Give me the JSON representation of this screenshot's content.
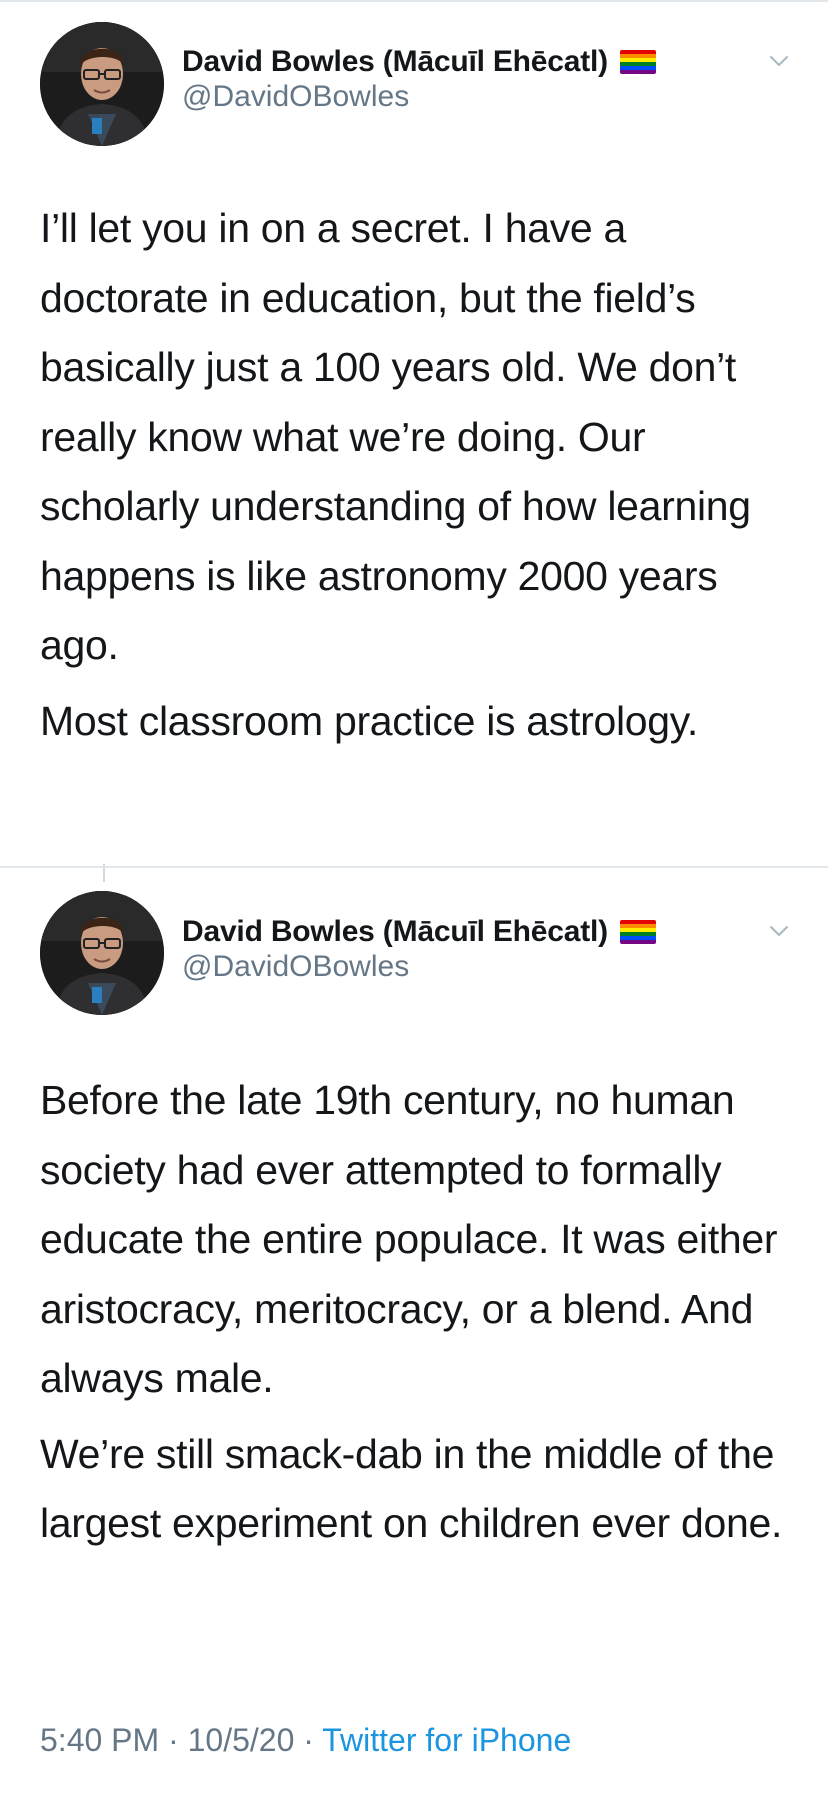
{
  "tweets": [
    {
      "author": {
        "display_name": "David Bowles (Mācuīl Ehēcatl)",
        "handle": "@DavidOBowles",
        "avatar_icon": "profile-photo-man-glasses",
        "name_badge_icon": "rainbow-flag-icon"
      },
      "paragraphs": [
        "I’ll let you in on a secret. I have a doctorate in education, but the field’s basically just a 100 years old. We don’t really know what we’re doing. Our scholarly understanding of how learning happens is like astronomy 2000 years ago.",
        "Most classroom practice is astrology."
      ],
      "menu_icon": "chevron-down-icon"
    },
    {
      "author": {
        "display_name": "David Bowles (Mācuīl Ehēcatl)",
        "handle": "@DavidOBowles",
        "avatar_icon": "profile-photo-man-glasses",
        "name_badge_icon": "rainbow-flag-icon"
      },
      "paragraphs": [
        "Before the late 19th century, no human society had ever attempted to formally educate the entire populace. It was either aristocracy, meritocracy, or a blend. And always male.",
        "We’re still smack-dab in the middle of the largest experiment on children ever done."
      ],
      "menu_icon": "chevron-down-icon",
      "timestamp": "5:40 PM · 10/5/20 · ",
      "source": "Twitter for iPhone"
    }
  ],
  "colors": {
    "text_primary": "#14171a",
    "text_secondary": "#657786",
    "link": "#1b95e0",
    "divider": "#e1e6ea"
  }
}
